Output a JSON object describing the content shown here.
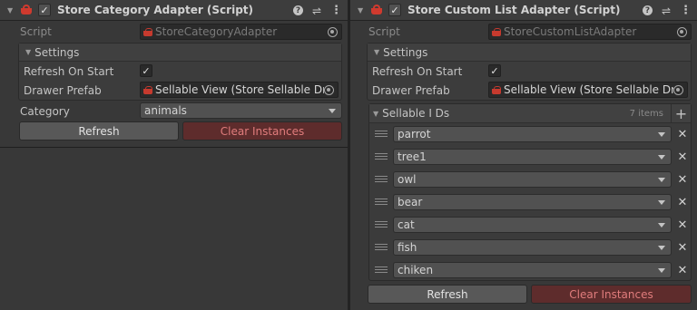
{
  "left": {
    "title": "Store Category Adapter (Script)",
    "script_label": "Script",
    "script_value": "StoreCategoryAdapter",
    "settings_title": "Settings",
    "refresh_on_start_label": "Refresh On Start",
    "refresh_on_start_checked": true,
    "drawer_prefab_label": "Drawer Prefab",
    "drawer_prefab_value": "Sellable View (Store Sellable Dra",
    "category_label": "Category",
    "category_value": "animals",
    "refresh_button": "Refresh",
    "clear_button": "Clear Instances"
  },
  "right": {
    "title": "Store Custom List Adapter (Script)",
    "script_label": "Script",
    "script_value": "StoreCustomListAdapter",
    "settings_title": "Settings",
    "refresh_on_start_label": "Refresh On Start",
    "refresh_on_start_checked": true,
    "drawer_prefab_label": "Drawer Prefab",
    "drawer_prefab_value": "Sellable View (Store Sellable Dra",
    "list_title": "Sellable I Ds",
    "list_count": "7 items",
    "items": [
      "parrot",
      "tree1",
      "owl",
      "bear",
      "cat",
      "fish",
      "chiken"
    ],
    "refresh_button": "Refresh",
    "clear_button": "Clear Instances"
  },
  "icons": {
    "component": "basket-icon",
    "help": "help-icon",
    "presets": "presets-icon",
    "menu": "kebab-menu-icon",
    "object_picker": "object-picker-icon",
    "add": "plus-icon",
    "remove": "close-icon",
    "drag": "drag-handle-icon"
  },
  "colors": {
    "panel_bg": "#383838",
    "header_bg": "#3d3d3d",
    "basket_red": "#d03a2e",
    "danger_button_bg": "#5e2c2c",
    "danger_button_text": "#e07c7c"
  }
}
